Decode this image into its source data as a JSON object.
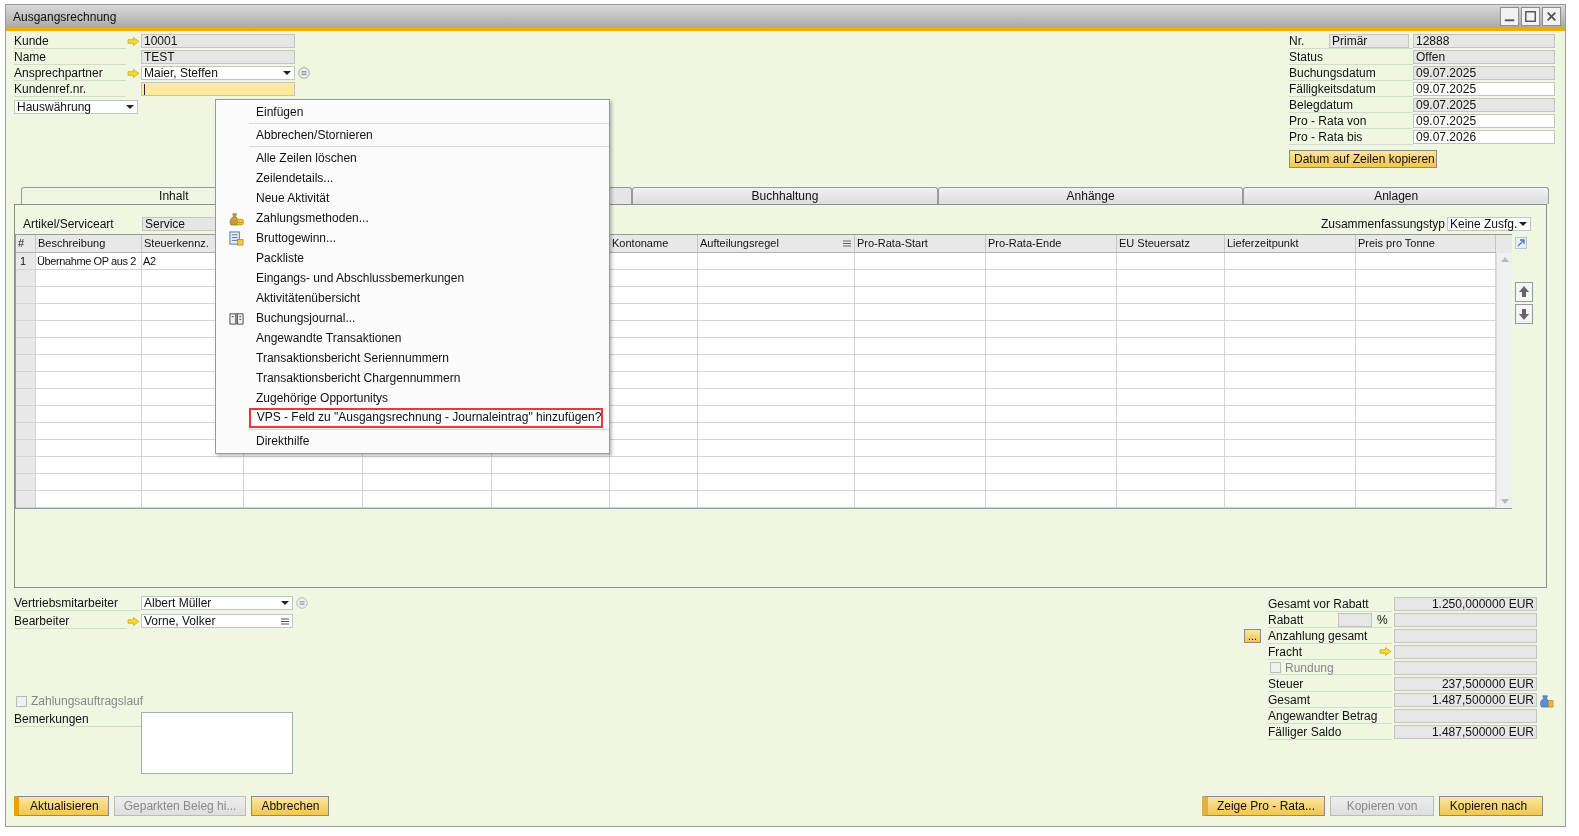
{
  "window": {
    "title": "Ausgangsrechnung"
  },
  "header_left": [
    {
      "label": "Kunde",
      "value": "10001",
      "kind": "text",
      "linked": true,
      "readonly": true
    },
    {
      "label": "Name",
      "value": "TEST",
      "kind": "text",
      "readonly": true
    },
    {
      "label": "Ansprechpartner",
      "value": "Maier, Steffen",
      "kind": "dropdown",
      "linked": true,
      "readonly": false,
      "info": true
    },
    {
      "label": "Kundenref.nr.",
      "kind": "text",
      "focused": true
    }
  ],
  "currency": {
    "value": "Hauswährung"
  },
  "header_right": [
    {
      "label": "Nr.",
      "series": "Primär",
      "value": "12888",
      "readonly": true
    },
    {
      "label": "Status",
      "value": "Offen",
      "readonly": true
    },
    {
      "label": "Buchungsdatum",
      "value": "09.07.2025",
      "readonly": true
    },
    {
      "label": "Fälligkeitsdatum",
      "value": "09.07.2025",
      "readonly": false
    },
    {
      "label": "Belegdatum",
      "value": "09.07.2025",
      "readonly": true
    },
    {
      "label": "Pro - Rata von",
      "value": "09.07.2025",
      "readonly": false
    },
    {
      "label": "Pro - Rata bis",
      "value": "09.07.2026",
      "readonly": false
    }
  ],
  "copy_dates_button": "Datum auf Zeilen kopieren",
  "tabs": [
    {
      "label": "Inhalt",
      "selected": true
    },
    {
      "label": "Buchhaltung",
      "selected": false
    },
    {
      "label": "Anhänge",
      "selected": false
    },
    {
      "label": "Anlagen",
      "selected": false
    }
  ],
  "item_type": {
    "label": "Artikel/Serviceart",
    "value": "Service"
  },
  "summary_type": {
    "label": "Zusammenfassungstyp",
    "value": "Keine Zusfg."
  },
  "table": {
    "columns": [
      "#",
      "Beschreibung",
      "Steuerkennz.",
      "Kontoname",
      "Aufteilungsregel",
      "Pro-Rata-Start",
      "Pro-Rata-Ende",
      "EU Steuersatz",
      "Lieferzeitpunkt",
      "Preis pro Tonne"
    ],
    "rows": [
      [
        "1",
        "Übernahme OP aus 2",
        "A2"
      ]
    ]
  },
  "sales_employee": {
    "label": "Vertriebsmitarbeiter",
    "value": "Albert Müller"
  },
  "owner": {
    "label": "Bearbeiter",
    "value": "Vorne, Volker"
  },
  "payment_run": {
    "label": "Zahlungsauftragslauf",
    "checked": false,
    "disabled": true
  },
  "remarks": {
    "label": "Bemerkungen"
  },
  "totals": [
    {
      "label": "Gesamt vor Rabatt",
      "value": "1.250,000000 EUR",
      "kind": "plain"
    },
    {
      "label": "Rabatt",
      "unit": "%",
      "kind": "percent"
    },
    {
      "label": "Anzahlung gesamt",
      "button": "...",
      "kind": "more"
    },
    {
      "label": "Fracht",
      "kind": "linked"
    },
    {
      "label": "Rundung",
      "kind": "checkbox",
      "checked": false,
      "disabled": true
    },
    {
      "label": "Steuer",
      "value": "237,500000 EUR",
      "kind": "plain"
    },
    {
      "label": "Gesamt",
      "value": "1.487,500000 EUR",
      "kind": "icon"
    },
    {
      "label": "Angewandter Betrag",
      "kind": "plain"
    },
    {
      "label": "Fälliger Saldo",
      "value": "1.487,500000 EUR",
      "kind": "plain"
    }
  ],
  "buttons_left": [
    {
      "label": "Aktualisieren",
      "disabled": false,
      "default": true
    },
    {
      "label": "Geparkten Beleg hi...",
      "disabled": true,
      "default": false
    },
    {
      "label": "Abbrechen",
      "disabled": false,
      "default": false
    }
  ],
  "buttons_right": [
    {
      "label": "Zeige Pro - Rata...",
      "disabled": false,
      "kind": "menu-left"
    },
    {
      "label": "Kopieren von",
      "disabled": true,
      "kind": "plain"
    },
    {
      "label": "Kopieren nach",
      "disabled": false,
      "kind": "menu-right"
    }
  ],
  "context_menu": [
    {
      "label": "Einfügen",
      "separator_after": true
    },
    {
      "label": "Abbrechen/Stornieren",
      "separator_after": true
    },
    {
      "label": "Alle Zeilen löschen"
    },
    {
      "label": "Zeilendetails..."
    },
    {
      "label": "Neue Aktivität"
    },
    {
      "label": "Zahlungsmethoden...",
      "kind": "coins"
    },
    {
      "label": "Bruttogewinn...",
      "kind": "sheet"
    },
    {
      "label": "Packliste"
    },
    {
      "label": "Eingangs- und Abschlussbemerkungen"
    },
    {
      "label": "Aktivitätenübersicht"
    },
    {
      "label": "Buchungsjournal...",
      "kind": "book"
    },
    {
      "label": "Angewandte Transaktionen"
    },
    {
      "label": "Transaktionsbericht Seriennummern"
    },
    {
      "label": "Transaktionsbericht Chargennummern"
    },
    {
      "label": "Zugehörige Opportunitys"
    },
    {
      "label": "VPS - Feld zu \"Ausgangsrechnung - Journaleintrag\" hinzufügen?",
      "highlighted": true,
      "separator_after": true
    },
    {
      "label": "Direkthilfe"
    }
  ]
}
